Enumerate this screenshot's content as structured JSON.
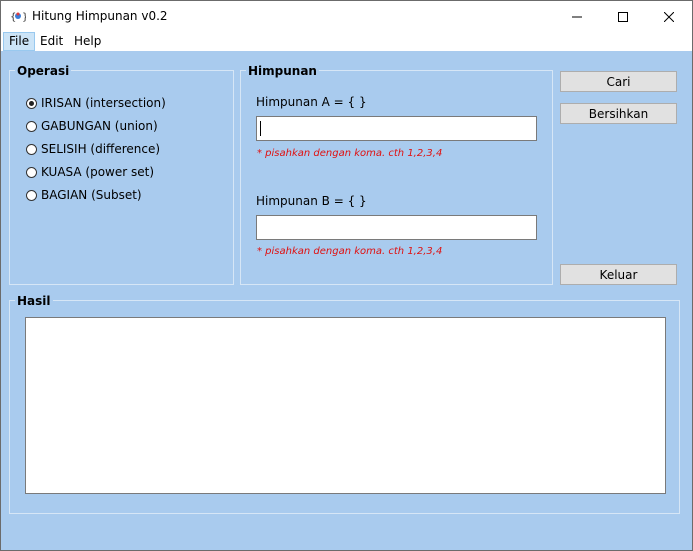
{
  "window": {
    "title": "Hitung Himpunan v0.2"
  },
  "menu": {
    "items": [
      "File",
      "Edit",
      "Help"
    ]
  },
  "operasi": {
    "title": "Operasi",
    "options": [
      {
        "label": "IRISAN (intersection)",
        "checked": true
      },
      {
        "label": "GABUNGAN (union)",
        "checked": false
      },
      {
        "label": "SELISIH (difference)",
        "checked": false
      },
      {
        "label": "KUASA (power set)",
        "checked": false
      },
      {
        "label": "BAGIAN (Subset)",
        "checked": false
      }
    ]
  },
  "himpunan": {
    "title": "Himpunan",
    "a_label": "Himpunan A = {  }",
    "a_value": "",
    "a_hint": "* pisahkan dengan koma. cth 1,2,3,4",
    "b_label": "Himpunan B = {  }",
    "b_value": "",
    "b_hint": "* pisahkan dengan koma. cth 1,2,3,4"
  },
  "buttons": {
    "cari": "Cari",
    "bersihkan": "Bersihkan",
    "keluar": "Keluar"
  },
  "hasil": {
    "title": "Hasil",
    "value": ""
  },
  "colors": {
    "panel_bg": "#a9cbee",
    "hint_red": "#e01010"
  }
}
